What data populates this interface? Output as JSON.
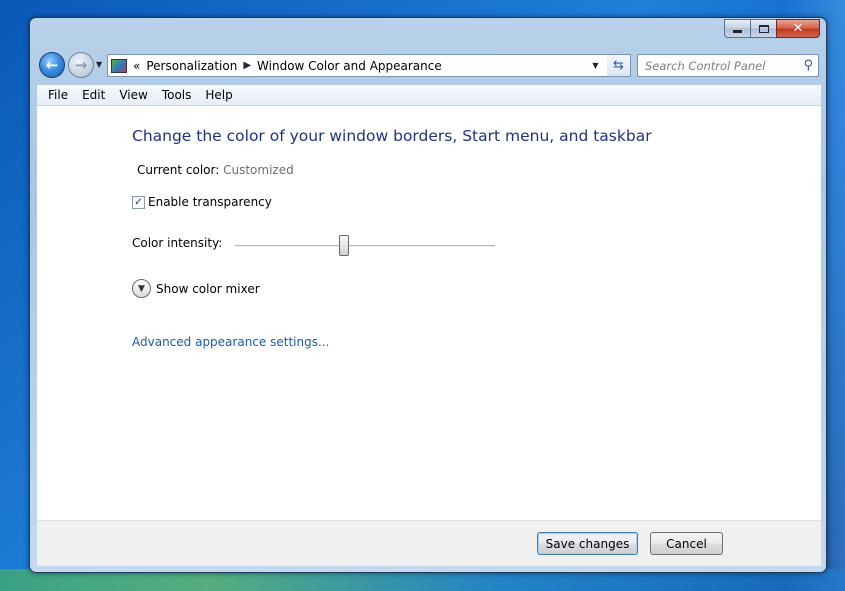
{
  "address_bar": {
    "crumb_prefix": "«",
    "crumbs": [
      "Personalization",
      "Window Color and Appearance"
    ]
  },
  "search": {
    "placeholder": "Search Control Panel"
  },
  "menu": [
    "File",
    "Edit",
    "View",
    "Tools",
    "Help"
  ],
  "content": {
    "heading": "Change the color of your window borders, Start menu, and taskbar",
    "current_color_label": "Current color:",
    "current_color_value": "Customized",
    "transparency_label": "Enable transparency",
    "transparency_checked": true,
    "intensity_label": "Color intensity:",
    "intensity_value": 0.42,
    "mixer_label": "Show color mixer",
    "advanced_link": "Advanced appearance settings..."
  },
  "buttons": {
    "save": "Save changes",
    "cancel": "Cancel"
  },
  "colors": {
    "heading": "#1e3287",
    "link": "#1a5bb5",
    "muted": "#6d6d6d"
  }
}
